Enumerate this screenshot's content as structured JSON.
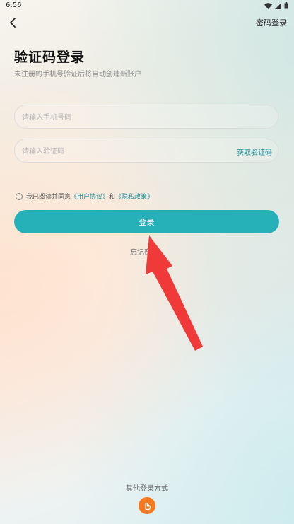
{
  "status_bar": {
    "time": "6:56"
  },
  "header": {
    "back_icon": "back-arrow-icon",
    "password_login": "密码登录"
  },
  "page": {
    "title": "验证码登录",
    "subtitle": "未注册的手机号验证后将自动创建新账户"
  },
  "form": {
    "phone_placeholder": "请输入手机号码",
    "code_placeholder": "请输入验证码",
    "get_code": "获取验证码",
    "agreement": {
      "prefix": "我已阅读并同意",
      "user_agreement": "《用户协议》",
      "and": "和",
      "privacy_policy": "《隐私政策》",
      "checked": false
    },
    "login_button": "登录",
    "forgot": "忘记密码"
  },
  "footer": {
    "other_login": "其他登录方式",
    "fingerprint_icon": "fingerprint-icon"
  },
  "colors": {
    "accent": "#26b1b9",
    "link": "#1f8f9a",
    "annotation_arrow": "#f03a3a",
    "fingerprint_bg": "#f6781f"
  }
}
